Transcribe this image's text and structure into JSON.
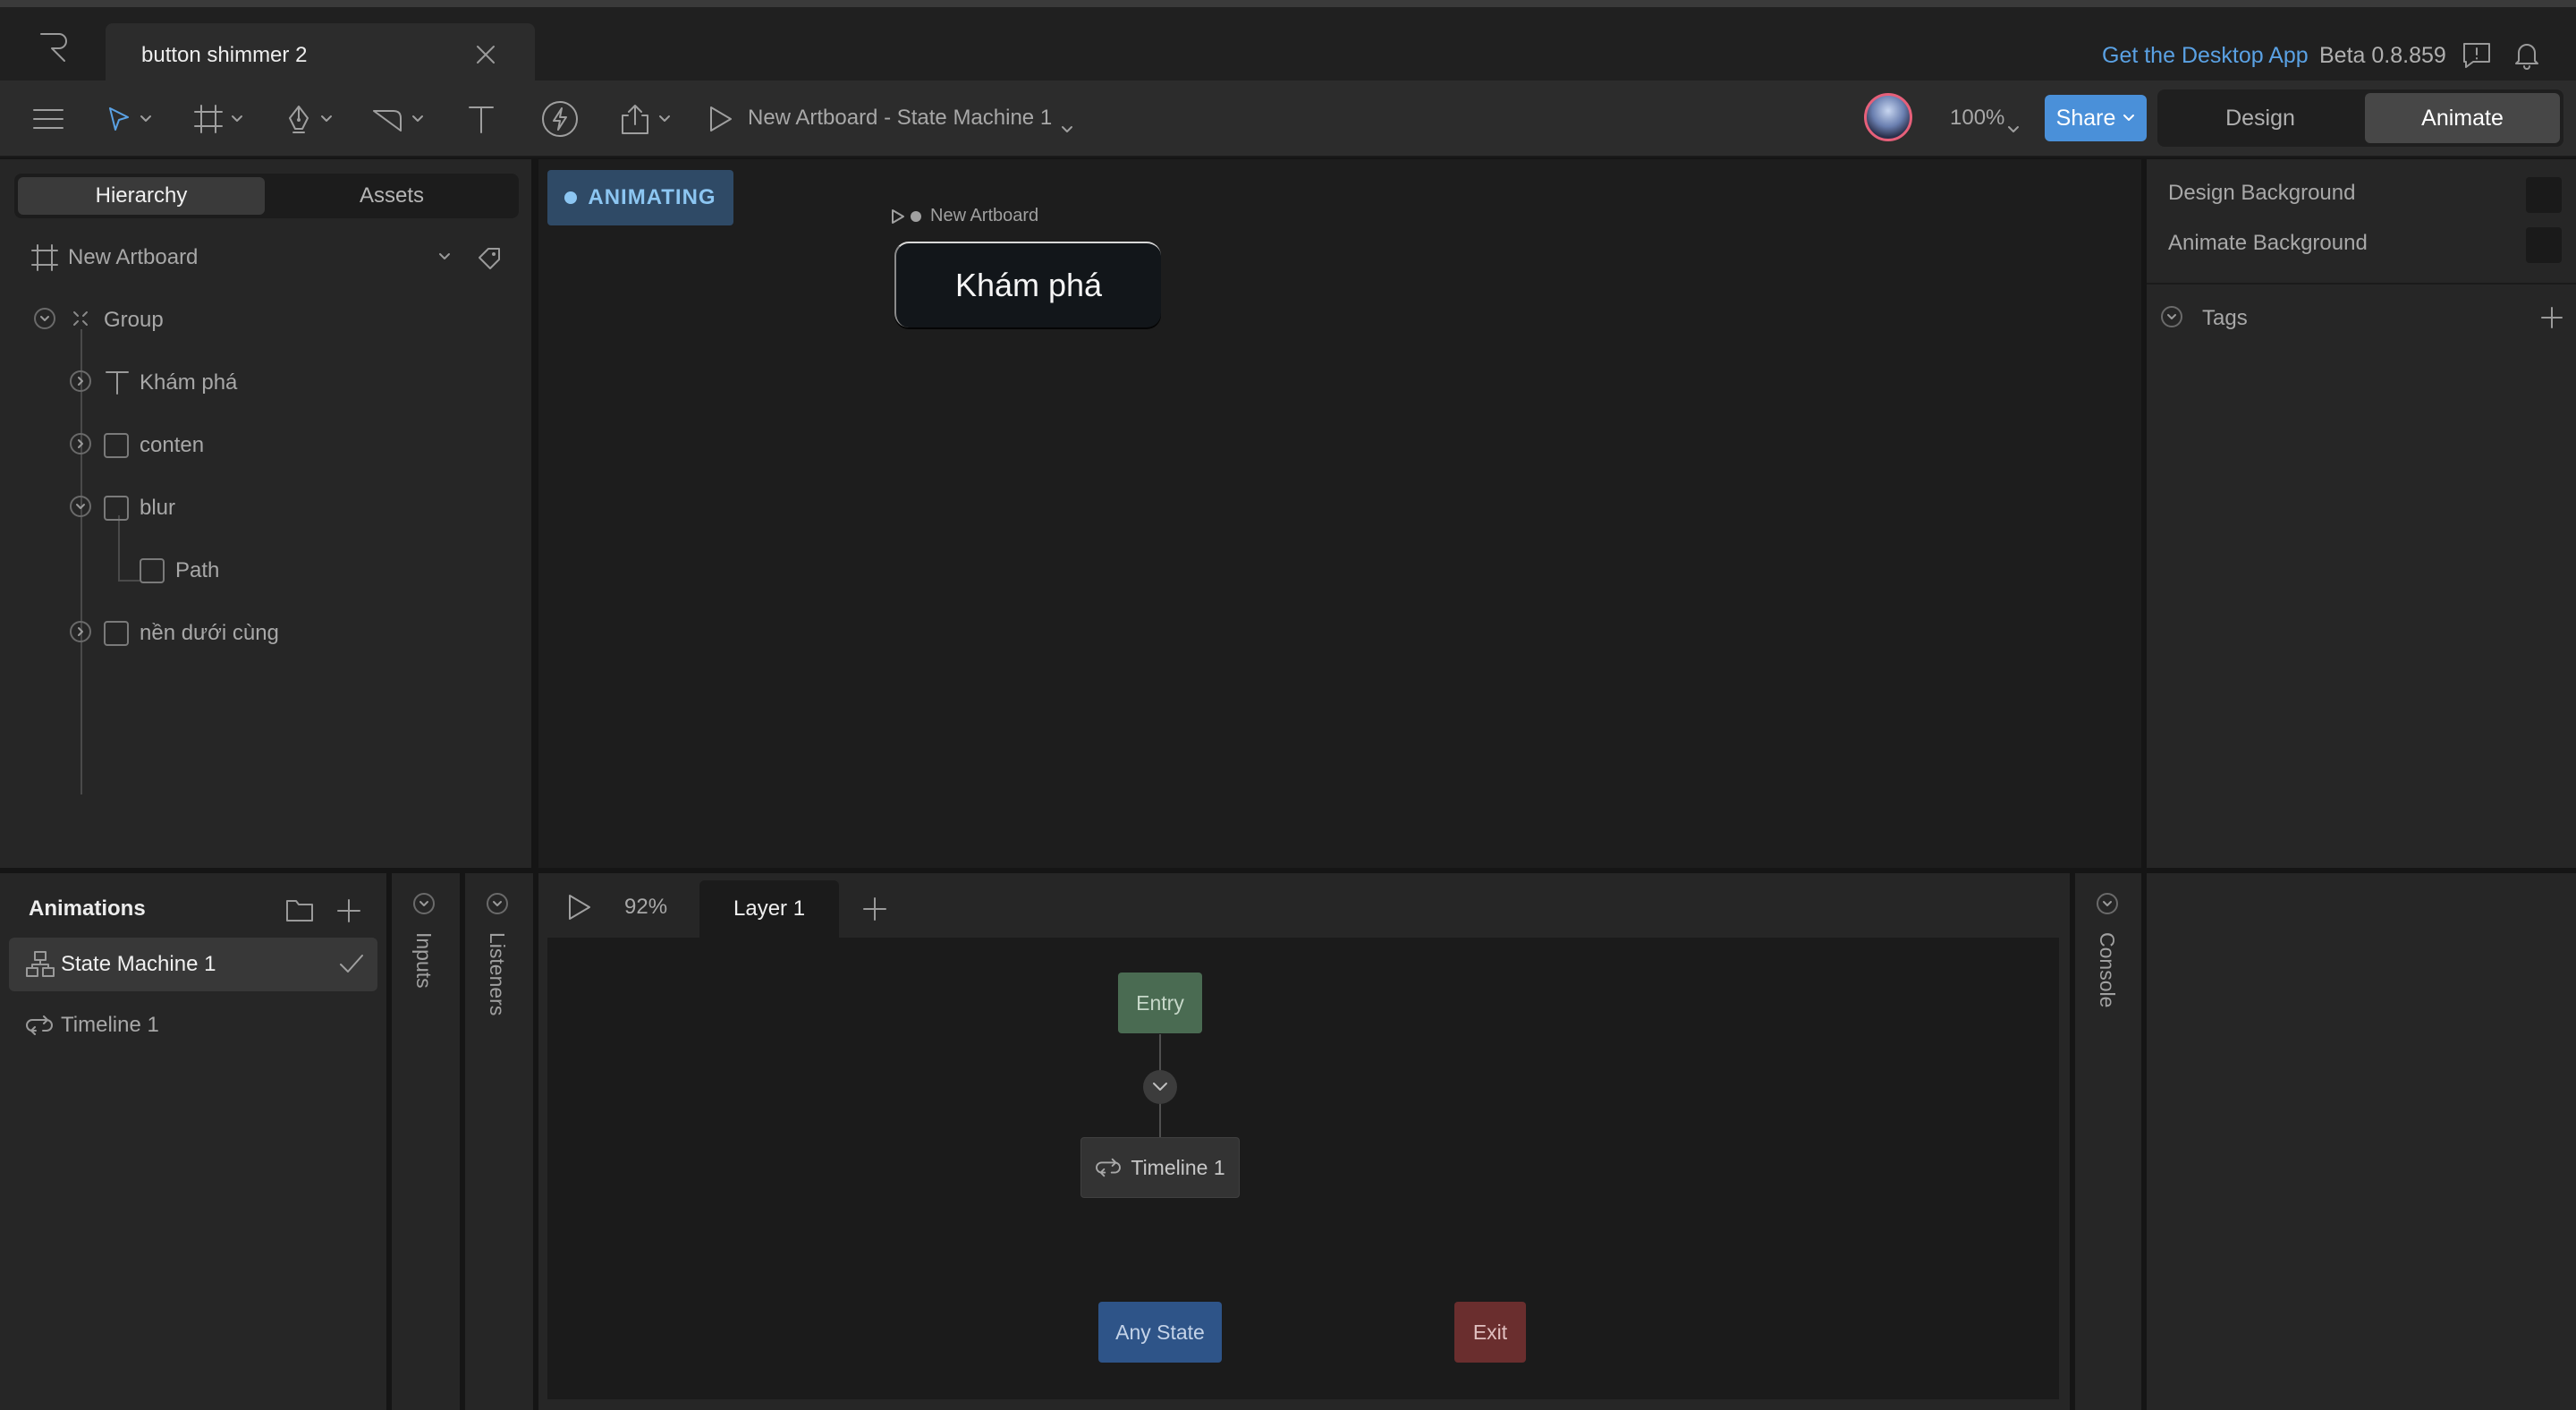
{
  "tab": {
    "title": "button shimmer 2"
  },
  "header": {
    "desktop_link": "Get the Desktop App",
    "version": "Beta 0.8.859"
  },
  "toolbar": {
    "state_machine_title": "New Artboard - State Machine 1",
    "zoom": "100%",
    "share_label": "Share",
    "design_label": "Design",
    "animate_label": "Animate"
  },
  "left_panel": {
    "hierarchy_tab": "Hierarchy",
    "assets_tab": "Assets",
    "artboard_name": "New Artboard",
    "tree": [
      {
        "label": "Group"
      },
      {
        "label": "Khám phá"
      },
      {
        "label": "conten"
      },
      {
        "label": "blur"
      },
      {
        "label": "Path"
      },
      {
        "label": "nền dưới cùng"
      }
    ]
  },
  "canvas": {
    "badge": "ANIMATING",
    "artboard_label": "New Artboard",
    "button_text": "Khám phá"
  },
  "right_panel": {
    "design_background": "Design Background",
    "animate_background": "Animate Background",
    "tags": "Tags"
  },
  "animations": {
    "title": "Animations",
    "items": [
      {
        "label": "State Machine 1"
      },
      {
        "label": "Timeline 1"
      }
    ]
  },
  "strips": {
    "inputs": "Inputs",
    "listeners": "Listeners",
    "console": "Console"
  },
  "state_machine": {
    "zoom": "92%",
    "layer_tab": "Layer 1",
    "nodes": {
      "entry": "Entry",
      "timeline": "Timeline 1",
      "any_state": "Any State",
      "exit": "Exit"
    }
  },
  "colors": {
    "accent": "#4a90d9",
    "link": "#5aa1e3",
    "animating_badge": "#2f4a66",
    "entry_node": "#4a6b52",
    "any_state_node": "#2e5488",
    "exit_node": "#6a2e2e"
  }
}
